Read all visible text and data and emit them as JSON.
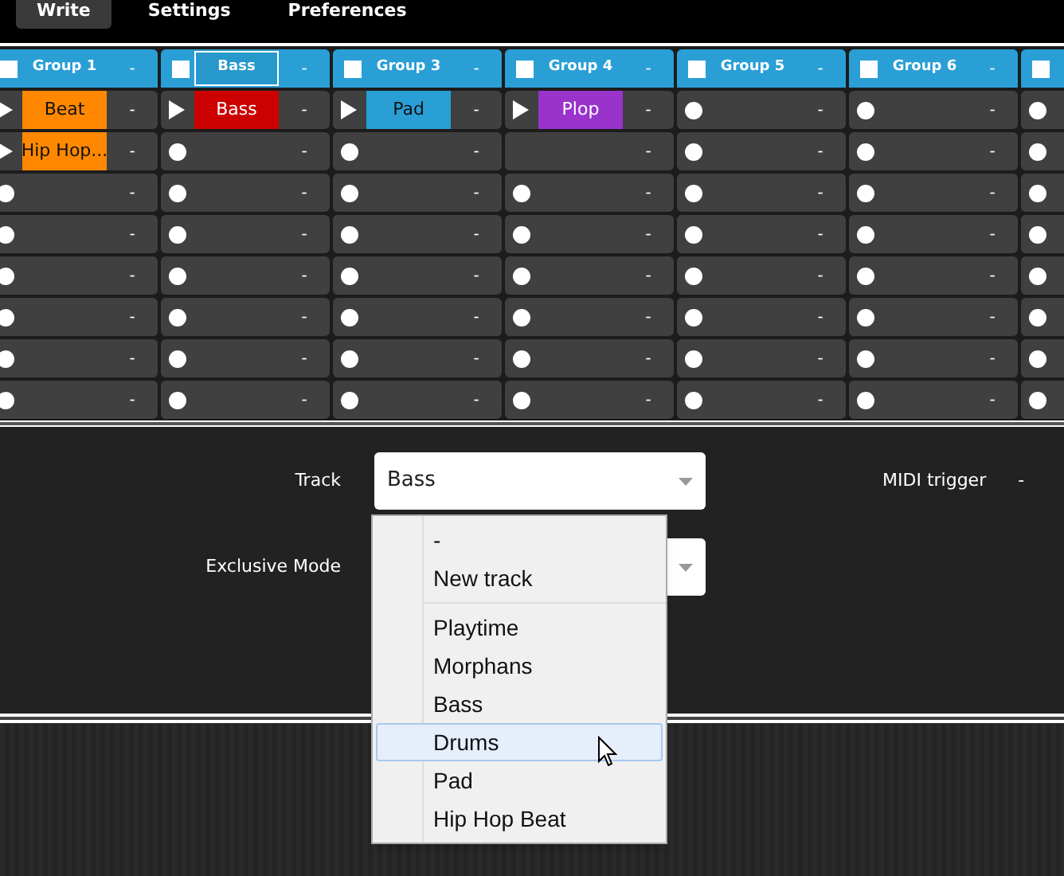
{
  "tabs": [
    {
      "label": "Write",
      "selected": true
    },
    {
      "label": "Settings",
      "selected": false
    },
    {
      "label": "Preferences",
      "selected": false
    }
  ],
  "groups": [
    {
      "label": "Group 1",
      "selected": false,
      "checked": false,
      "trigger": "-",
      "cells": [
        {
          "kind": "clip",
          "label": "Beat",
          "color": "#ff8800",
          "trigger": "-"
        },
        {
          "kind": "clip",
          "label": "Hip Hop...",
          "color": "#ff8800",
          "trigger": "-"
        },
        {
          "kind": "empty",
          "trigger": "-"
        },
        {
          "kind": "empty",
          "trigger": "-"
        },
        {
          "kind": "empty",
          "trigger": "-"
        },
        {
          "kind": "empty",
          "trigger": "-"
        },
        {
          "kind": "empty",
          "trigger": "-"
        },
        {
          "kind": "empty",
          "trigger": "-"
        }
      ]
    },
    {
      "label": "Bass",
      "selected": true,
      "checked": false,
      "trigger": "-",
      "cells": [
        {
          "kind": "clip",
          "label": "Bass",
          "color": "#cc0000",
          "trigger": "-"
        },
        {
          "kind": "empty",
          "trigger": "-"
        },
        {
          "kind": "empty",
          "trigger": "-"
        },
        {
          "kind": "empty",
          "trigger": "-"
        },
        {
          "kind": "empty",
          "trigger": "-"
        },
        {
          "kind": "empty",
          "trigger": "-"
        },
        {
          "kind": "empty",
          "trigger": "-"
        },
        {
          "kind": "empty",
          "trigger": "-"
        }
      ]
    },
    {
      "label": "Group 3",
      "selected": false,
      "checked": false,
      "trigger": "-",
      "cells": [
        {
          "kind": "clip",
          "label": "Pad",
          "color": "#2a9fd6",
          "trigger": "-"
        },
        {
          "kind": "empty",
          "trigger": "-"
        },
        {
          "kind": "empty",
          "trigger": "-"
        },
        {
          "kind": "empty",
          "trigger": "-"
        },
        {
          "kind": "empty",
          "trigger": "-"
        },
        {
          "kind": "empty",
          "trigger": "-"
        },
        {
          "kind": "empty",
          "trigger": "-"
        },
        {
          "kind": "empty",
          "trigger": "-"
        }
      ]
    },
    {
      "label": "Group 4",
      "selected": false,
      "checked": false,
      "trigger": "-",
      "cells": [
        {
          "kind": "clip",
          "label": "Plop",
          "color": "#9933cc",
          "trigger": "-"
        },
        {
          "kind": "blank",
          "trigger": "-"
        },
        {
          "kind": "empty",
          "trigger": "-"
        },
        {
          "kind": "empty",
          "trigger": "-"
        },
        {
          "kind": "empty",
          "trigger": "-"
        },
        {
          "kind": "empty",
          "trigger": "-"
        },
        {
          "kind": "empty",
          "trigger": "-"
        },
        {
          "kind": "empty",
          "trigger": "-"
        }
      ]
    },
    {
      "label": "Group 5",
      "selected": false,
      "checked": false,
      "trigger": "-",
      "cells": [
        {
          "kind": "empty",
          "trigger": "-"
        },
        {
          "kind": "empty",
          "trigger": "-"
        },
        {
          "kind": "empty",
          "trigger": "-"
        },
        {
          "kind": "empty",
          "trigger": "-"
        },
        {
          "kind": "empty",
          "trigger": "-"
        },
        {
          "kind": "empty",
          "trigger": "-"
        },
        {
          "kind": "empty",
          "trigger": "-"
        },
        {
          "kind": "empty",
          "trigger": "-"
        }
      ]
    },
    {
      "label": "Group 6",
      "selected": false,
      "checked": false,
      "trigger": "-",
      "cells": [
        {
          "kind": "empty",
          "trigger": "-"
        },
        {
          "kind": "empty",
          "trigger": "-"
        },
        {
          "kind": "empty",
          "trigger": "-"
        },
        {
          "kind": "empty",
          "trigger": "-"
        },
        {
          "kind": "empty",
          "trigger": "-"
        },
        {
          "kind": "empty",
          "trigger": "-"
        },
        {
          "kind": "empty",
          "trigger": "-"
        },
        {
          "kind": "empty",
          "trigger": "-"
        }
      ]
    },
    {
      "checked": false,
      "cells": [
        {
          "kind": "empty"
        },
        {
          "kind": "empty"
        },
        {
          "kind": "empty"
        },
        {
          "kind": "empty"
        },
        {
          "kind": "empty"
        },
        {
          "kind": "empty"
        },
        {
          "kind": "empty"
        },
        {
          "kind": "empty"
        }
      ]
    }
  ],
  "form": {
    "track_label": "Track",
    "track_value": "Bass",
    "midi_label": "MIDI trigger",
    "midi_value": "-",
    "exclusive_label": "Exclusive Mode"
  },
  "dropdown": {
    "options": [
      {
        "label": "-",
        "highlighted": false
      },
      {
        "label": "New track",
        "highlighted": false
      }
    ],
    "tracks": [
      {
        "label": "Playtime",
        "highlighted": false
      },
      {
        "label": "Morphans",
        "highlighted": false
      },
      {
        "label": "Bass",
        "highlighted": false
      },
      {
        "label": "Drums",
        "highlighted": true
      },
      {
        "label": "Pad",
        "highlighted": false
      },
      {
        "label": "Hip Hop Beat",
        "highlighted": false
      }
    ]
  }
}
